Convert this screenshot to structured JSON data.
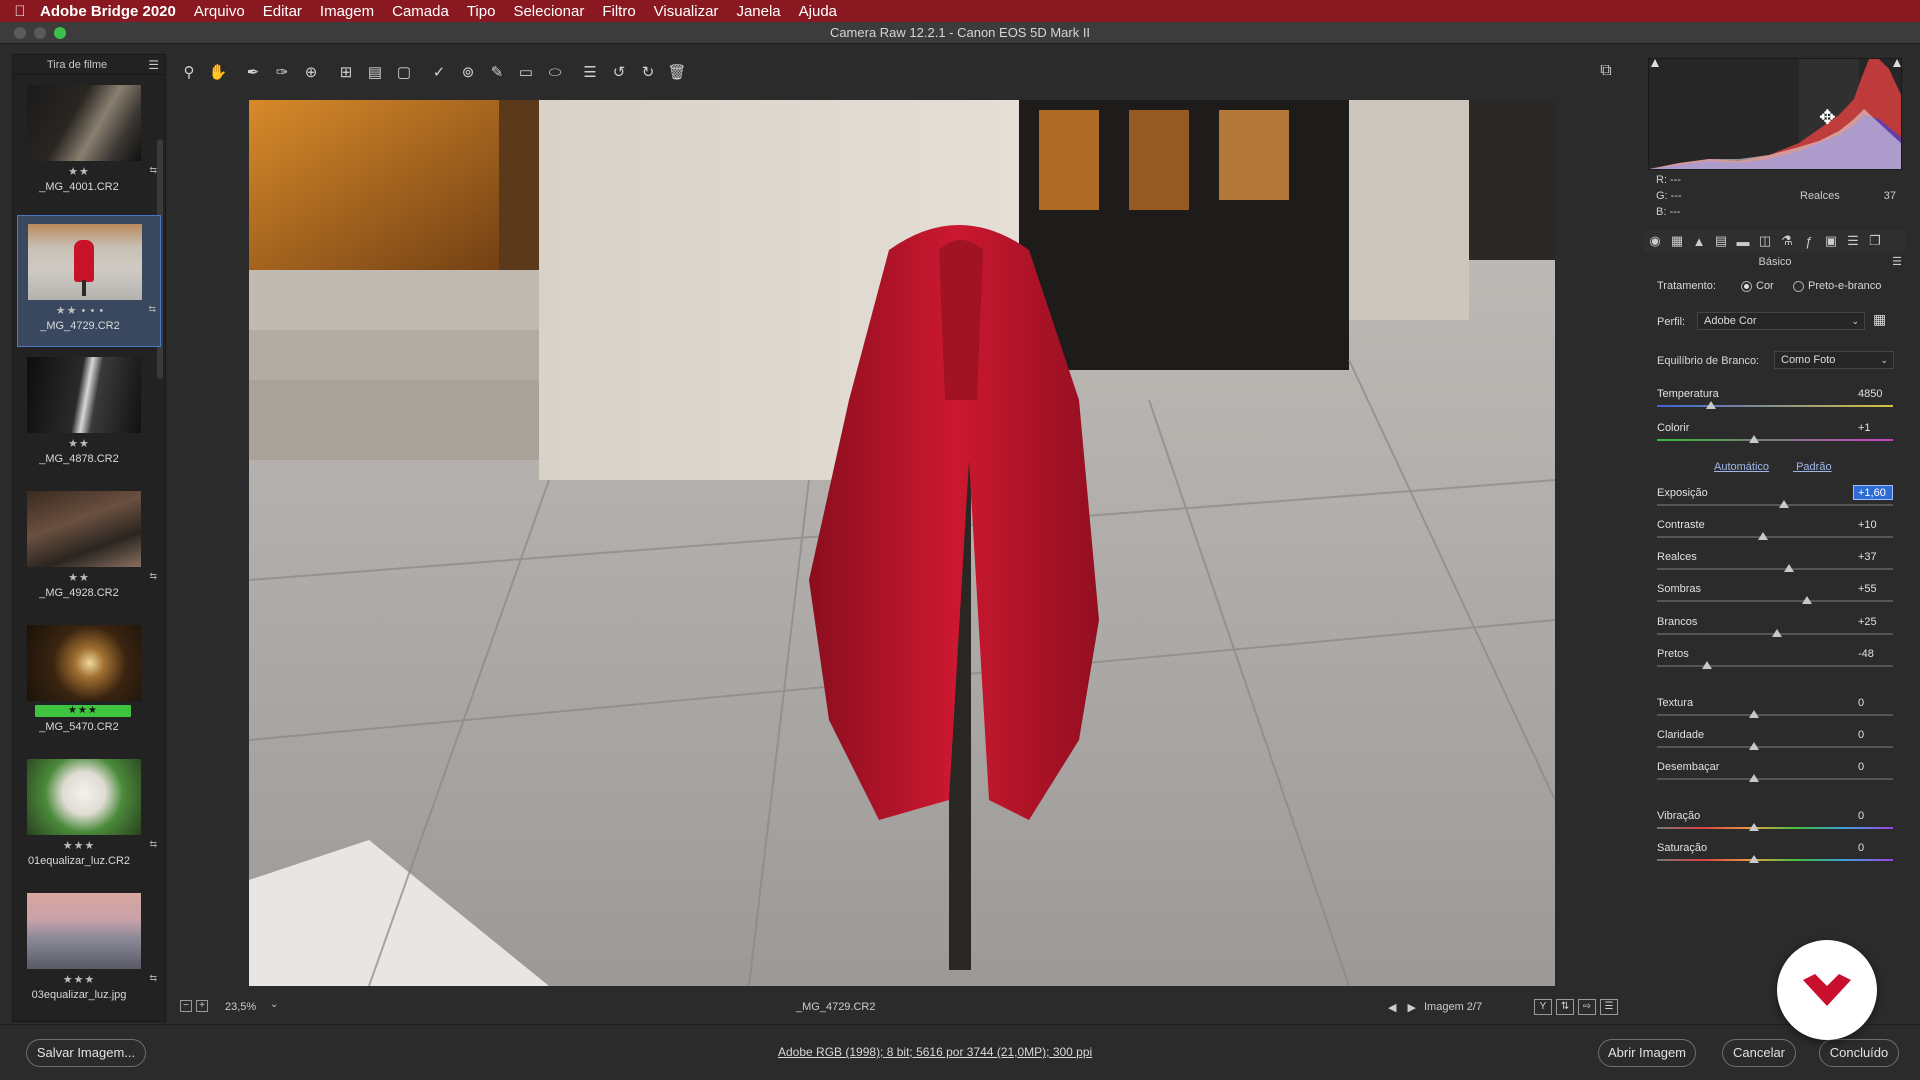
{
  "menubar": {
    "app_name": "Adobe Bridge 2020",
    "items": [
      "Arquivo",
      "Editar",
      "Imagem",
      "Camada",
      "Tipo",
      "Selecionar",
      "Filtro",
      "Visualizar",
      "Janela",
      "Ajuda"
    ]
  },
  "window": {
    "title": "Camera Raw 12.2.1  -  Canon EOS 5D Mark II"
  },
  "filmstrip": {
    "header": "Tira de filme",
    "items": [
      {
        "name": "_MG_4001.CR2",
        "stars": "★★"
      },
      {
        "name": "_MG_4729.CR2",
        "stars": "★★ • • •",
        "selected": true
      },
      {
        "name": "_MG_4878.CR2",
        "stars": "★★"
      },
      {
        "name": "_MG_4928.CR2",
        "stars": "★★"
      },
      {
        "name": "_MG_5470.CR2",
        "stars": "★★★",
        "label_color": "#3ec43e"
      },
      {
        "name": "01equalizar_luz.CR2",
        "stars": "★★★"
      },
      {
        "name": "03equalizar_luz.jpg",
        "stars": "★★★"
      }
    ]
  },
  "toolbar": {
    "icons": [
      "zoom-icon",
      "hand-icon",
      "white-balance-icon",
      "color-sampler-icon",
      "target-adjust-icon",
      "crop-icon",
      "straighten-icon",
      "transform-icon",
      "spot-removal-icon",
      "red-eye-icon",
      "adjustment-brush-icon",
      "graduated-filter-icon",
      "radial-filter-icon",
      "preferences-icon",
      "rotate-left-icon",
      "rotate-right-icon",
      "trash-icon"
    ]
  },
  "bottombar": {
    "zoom": "23,5%",
    "filename": "_MG_4729.CR2",
    "image_count": "Imagem 2/7"
  },
  "footer": {
    "save": "Salvar Imagem...",
    "info": "Adobe RGB (1998); 8 bit; 5616 por 3744 (21,0MP); 300 ppi",
    "open": "Abrir Imagem",
    "cancel": "Cancelar",
    "done": "Concluído"
  },
  "histogram": {
    "r": "R:   ---",
    "g": "G:   ---",
    "b": "B:   ---",
    "readout_label": "Realces",
    "readout_value": "37"
  },
  "panel": {
    "section": "Básico",
    "treatment_label": "Tratamento:",
    "treatment_color": "Cor",
    "treatment_bw": "Preto-e-branco",
    "profile_label": "Perfil:",
    "profile_value": "Adobe Cor",
    "wb_label": "Equilíbrio de Branco:",
    "wb_value": "Como Foto",
    "auto": "Automático",
    "default": "Padrão",
    "sliders": [
      {
        "name": "Temperatura",
        "value": "4850",
        "pos": 0.23,
        "track": "temp"
      },
      {
        "name": "Colorir",
        "value": "+1",
        "pos": 0.41,
        "track": "tint"
      },
      {
        "name": "Exposição",
        "value": "+1,60",
        "pos": 0.54,
        "active": true
      },
      {
        "name": "Contraste",
        "value": "+10",
        "pos": 0.45
      },
      {
        "name": "Realces",
        "value": "+37",
        "pos": 0.56
      },
      {
        "name": "Sombras",
        "value": "+55",
        "pos": 0.635
      },
      {
        "name": "Brancos",
        "value": "+25",
        "pos": 0.51
      },
      {
        "name": "Pretos",
        "value": "-48",
        "pos": 0.21
      },
      {
        "name": "Textura",
        "value": "0",
        "pos": 0.41
      },
      {
        "name": "Claridade",
        "value": "0",
        "pos": 0.41
      },
      {
        "name": "Desembaçar",
        "value": "0",
        "pos": 0.41
      },
      {
        "name": "Vibração",
        "value": "0",
        "pos": 0.41,
        "track": "vib"
      },
      {
        "name": "Saturação",
        "value": "0",
        "pos": 0.41,
        "track": "vib"
      }
    ]
  }
}
